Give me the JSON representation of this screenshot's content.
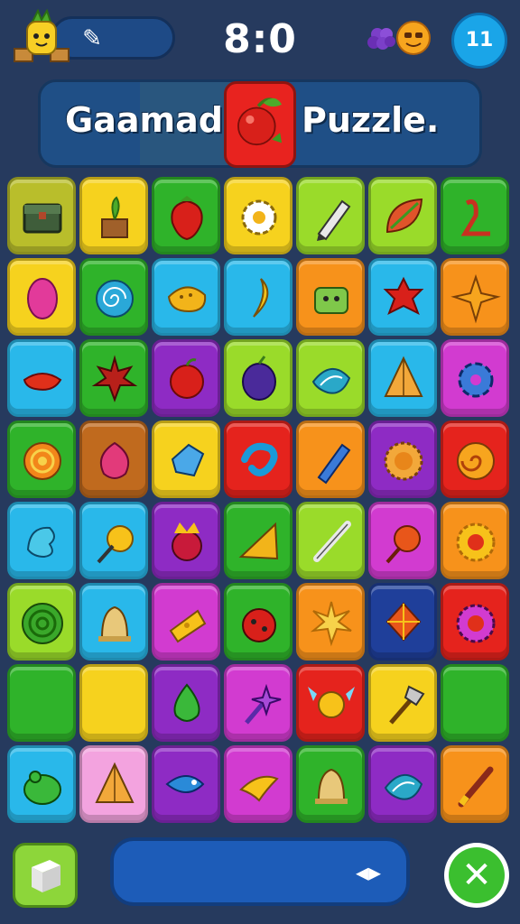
{
  "header": {
    "score": "8:0",
    "menu_button_label": "11"
  },
  "banner": {
    "title_left": "Gaamad",
    "title_right": "Puzzle."
  },
  "icons": {
    "mascot": "pineapple-mascot-icon",
    "edit": "edit-icon",
    "gems": [
      "grape-gem-icon",
      "orange-face-gem-icon"
    ],
    "banner_center": "apple-icon",
    "bottom_left": "cube-icon",
    "bottom_bar": "arrows-icon",
    "bottom_right": "close-icon"
  },
  "colors": {
    "background": "#263a5e",
    "yellow": "#f6d21e",
    "green": "#2fb32a",
    "lime": "#9adb2a",
    "cyan": "#29b8ea",
    "orange": "#f7921b",
    "purple": "#8e2bc4",
    "magenta": "#d23bd0",
    "red": "#e5231d",
    "pink": "#f3a3df",
    "navy": "#1f3f9a",
    "olive": "#b9be2b",
    "brown": "#c06a1e"
  },
  "board": {
    "rows": [
      [
        {
          "color": "olive",
          "icon": "treasure-chest-icon"
        },
        {
          "color": "yellow",
          "icon": "potted-plant-icon"
        },
        {
          "color": "green",
          "icon": "strawberry-icon"
        },
        {
          "color": "yellow",
          "icon": "gear-icon"
        },
        {
          "color": "lime",
          "icon": "pencil-icon"
        },
        {
          "color": "lime",
          "icon": "leaf-icon"
        },
        {
          "color": "green",
          "icon": "rune-icon"
        }
      ],
      [
        {
          "color": "yellow",
          "icon": "lemon-icon"
        },
        {
          "color": "green",
          "icon": "swirl-icon"
        },
        {
          "color": "cyan",
          "icon": "bread-icon"
        },
        {
          "color": "cyan",
          "icon": "banana-icon"
        },
        {
          "color": "orange",
          "icon": "robot-icon"
        },
        {
          "color": "cyan",
          "icon": "spiky-berry-icon"
        },
        {
          "color": "orange",
          "icon": "star-leaf-icon"
        }
      ],
      [
        {
          "color": "cyan",
          "icon": "chili-icon"
        },
        {
          "color": "green",
          "icon": "maple-leaf-icon"
        },
        {
          "color": "purple",
          "icon": "apple-icon"
        },
        {
          "color": "lime",
          "icon": "plum-icon"
        },
        {
          "color": "lime",
          "icon": "shell-icon"
        },
        {
          "color": "cyan",
          "icon": "pyramid-icon"
        },
        {
          "color": "magenta",
          "icon": "cog-icon"
        }
      ],
      [
        {
          "color": "green",
          "icon": "spiral-candy-icon"
        },
        {
          "color": "brown",
          "icon": "berry-icon"
        },
        {
          "color": "yellow",
          "icon": "crystal-icon"
        },
        {
          "color": "red",
          "icon": "wave-icon"
        },
        {
          "color": "orange",
          "icon": "pen-icon"
        },
        {
          "color": "purple",
          "icon": "sun-cookie-icon"
        },
        {
          "color": "red",
          "icon": "swirl-cookie-icon"
        }
      ],
      [
        {
          "color": "cyan",
          "icon": "dragon-icon"
        },
        {
          "color": "cyan",
          "icon": "cheese-wand-icon"
        },
        {
          "color": "purple",
          "icon": "crown-creature-icon"
        },
        {
          "color": "green",
          "icon": "pizza-slice-icon"
        },
        {
          "color": "lime",
          "icon": "quill-icon"
        },
        {
          "color": "magenta",
          "icon": "orange-wand-icon"
        },
        {
          "color": "orange",
          "icon": "flower-icon"
        }
      ],
      [
        {
          "color": "lime",
          "icon": "green-spiral-icon"
        },
        {
          "color": "cyan",
          "icon": "bell-icon"
        },
        {
          "color": "magenta",
          "icon": "cheese-icon"
        },
        {
          "color": "green",
          "icon": "ladybug-icon"
        },
        {
          "color": "orange",
          "icon": "starburst-icon"
        },
        {
          "color": "navy",
          "icon": "kite-icon"
        },
        {
          "color": "red",
          "icon": "sunflower-icon"
        }
      ],
      [
        {
          "color": "green",
          "icon": "blank-icon"
        },
        {
          "color": "yellow",
          "icon": "blank-icon"
        },
        {
          "color": "purple",
          "icon": "drop-icon"
        },
        {
          "color": "magenta",
          "icon": "magic-wand-icon"
        },
        {
          "color": "red",
          "icon": "fairy-icon"
        },
        {
          "color": "yellow",
          "icon": "axe-icon"
        },
        {
          "color": "green",
          "icon": "blank-icon"
        }
      ],
      [
        {
          "color": "cyan",
          "icon": "frog-icon"
        },
        {
          "color": "pink",
          "icon": "pyramid-icon"
        },
        {
          "color": "purple",
          "icon": "fish-icon"
        },
        {
          "color": "magenta",
          "icon": "bird-icon"
        },
        {
          "color": "green",
          "icon": "bell-icon"
        },
        {
          "color": "purple",
          "icon": "shell-icon"
        },
        {
          "color": "orange",
          "icon": "brush-icon"
        }
      ]
    ]
  }
}
